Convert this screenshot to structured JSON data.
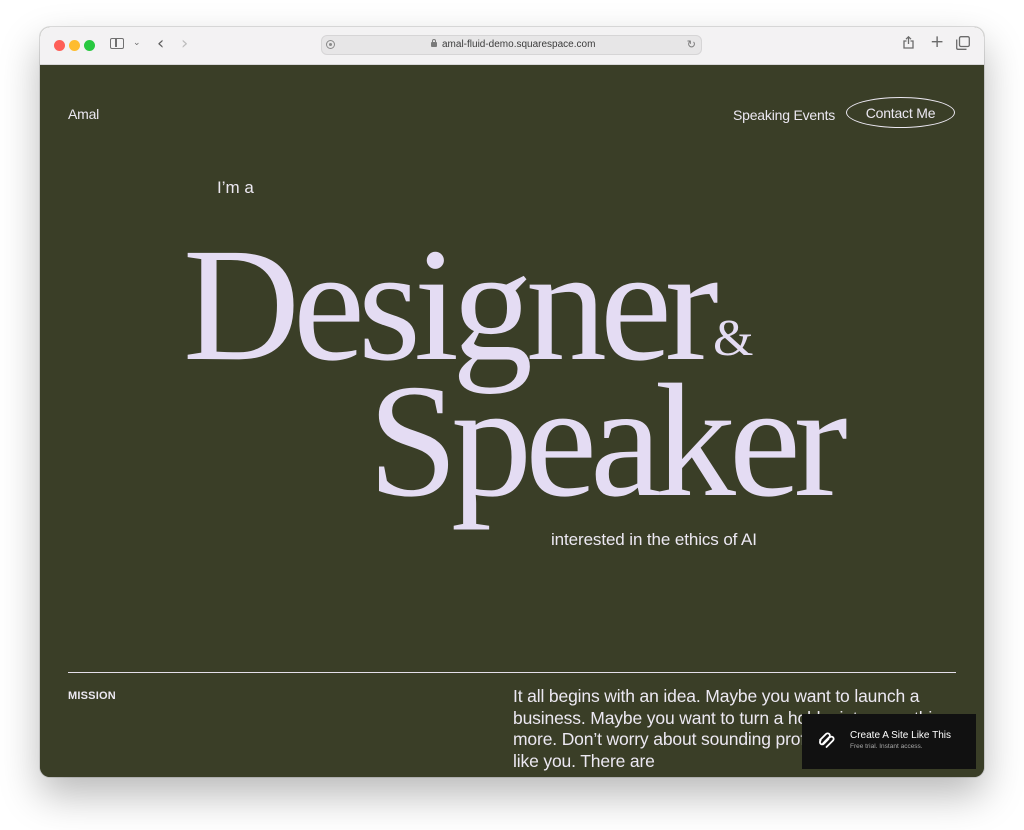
{
  "browser": {
    "url": "amal-fluid-demo.squarespace.com",
    "icons": {
      "sidebar": "sidebar-icon",
      "back": "chevron-left-icon",
      "forward": "chevron-right-icon",
      "share": "share-icon",
      "new_tab": "plus-icon",
      "tabs": "tabs-overview-icon"
    }
  },
  "header": {
    "site_title": "Amal",
    "nav_link": "Speaking Events",
    "contact_button": "Contact Me"
  },
  "hero": {
    "intro": "I’m a",
    "word_1": "Designer",
    "ampersand": "&",
    "word_2": "Speaker",
    "tagline": "interested in the ethics of AI"
  },
  "mission": {
    "label": "MISSION",
    "text": "It all begins with an idea. Maybe you want to launch a business. Maybe you want to turn a hobby into something more. Don’t worry about sounding professional. Sound like you. There are"
  },
  "promo": {
    "title": "Create A Site Like This",
    "subtitle": "Free trial. Instant access."
  },
  "colors": {
    "page_background": "#3a3e27",
    "hero_text": "#e4dcf3",
    "promo_background": "#111111"
  }
}
